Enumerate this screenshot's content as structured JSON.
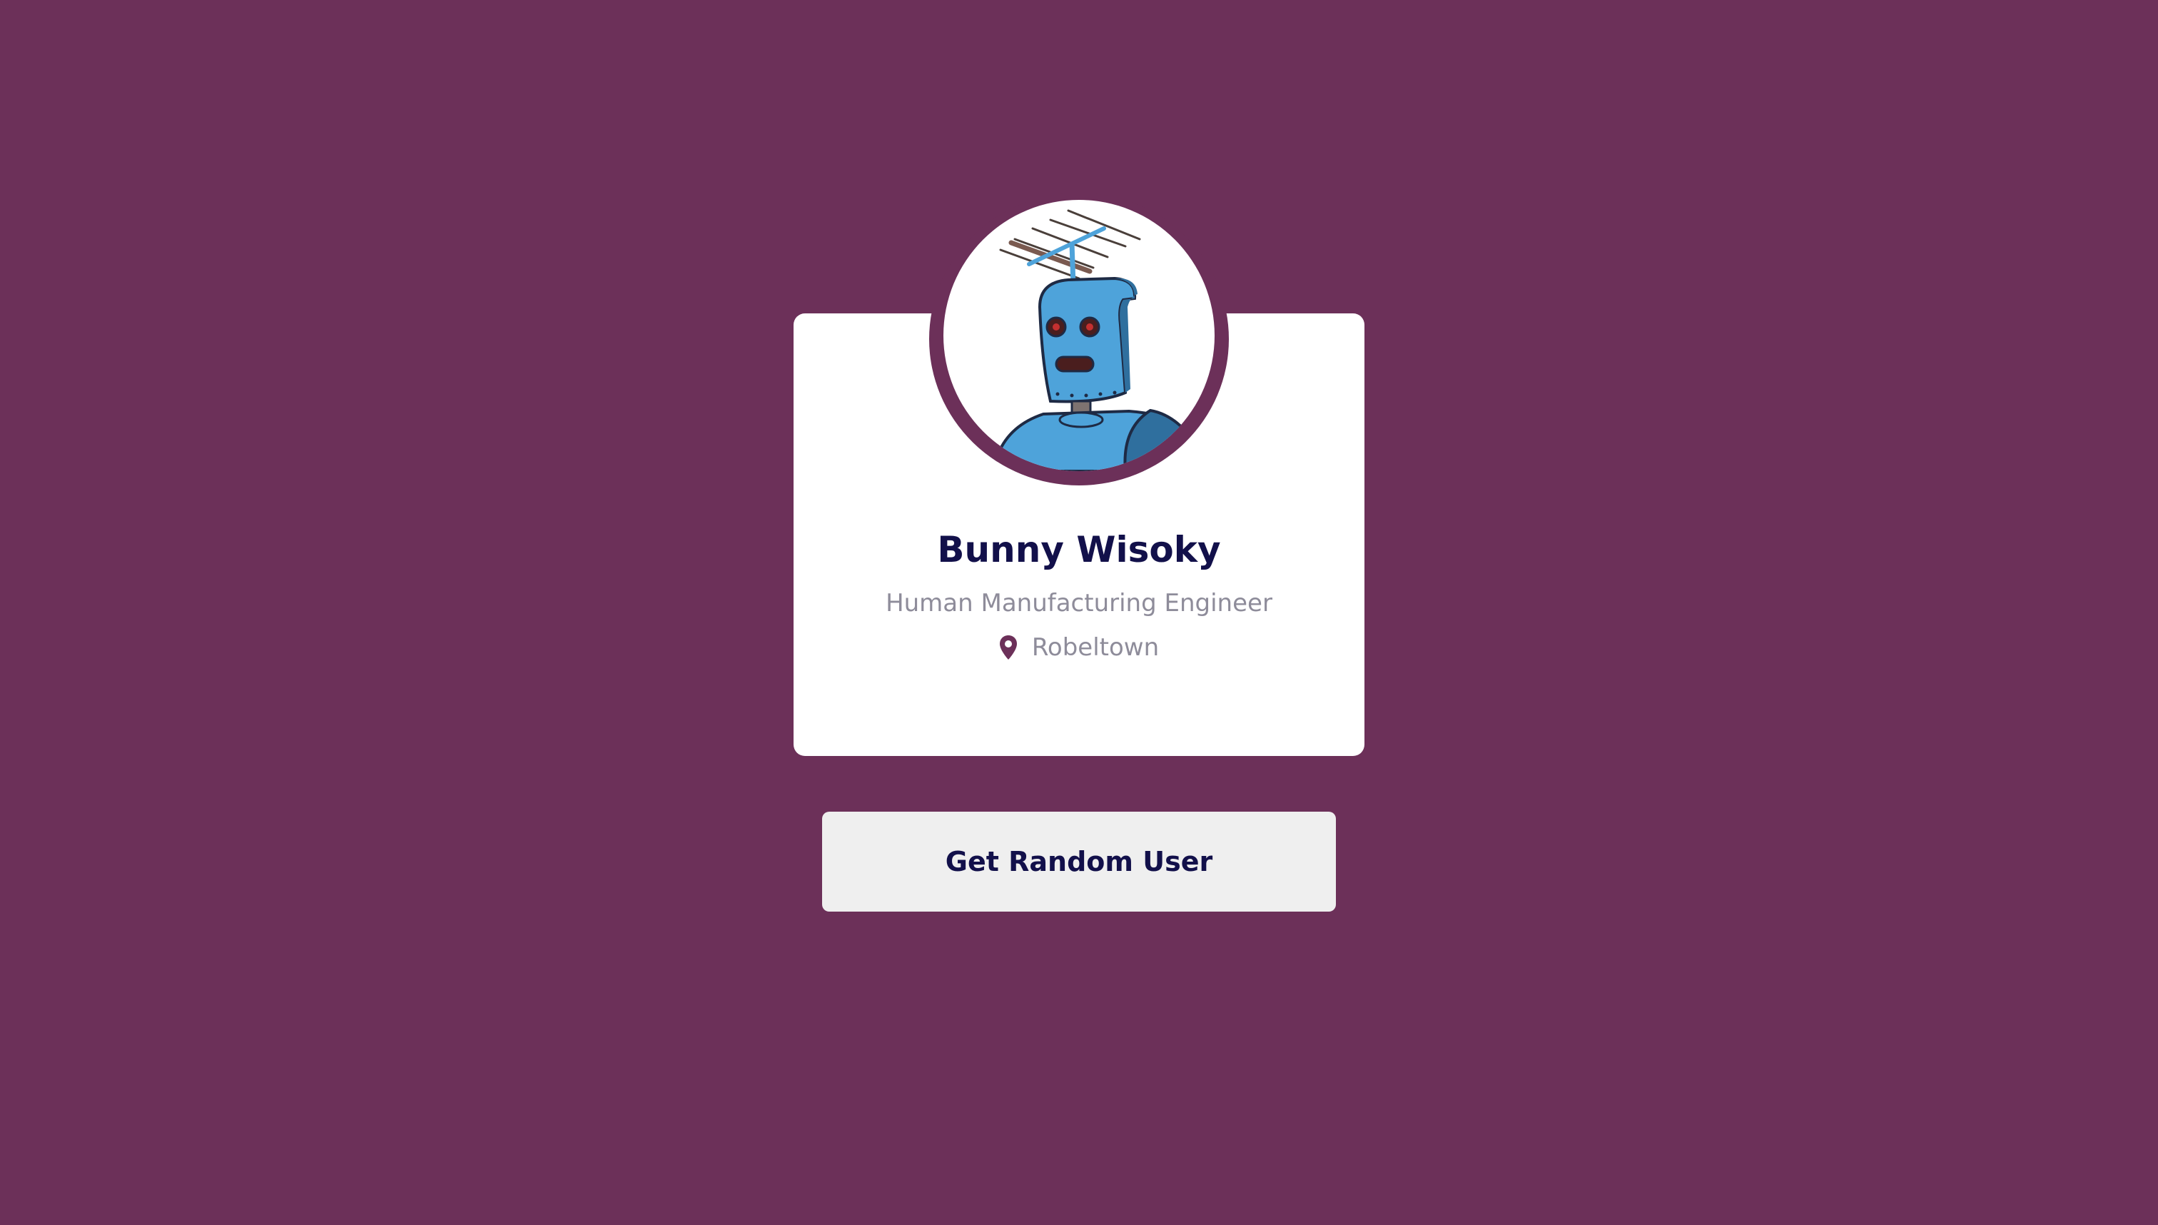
{
  "profile": {
    "name": "Bunny Wisoky",
    "job_title": "Human Manufacturing Engineer",
    "location": "Robeltown",
    "avatar_icon": "robot-avatar",
    "location_icon": "map-pin-icon"
  },
  "actions": {
    "random_user_label": "Get Random User"
  },
  "colors": {
    "background": "#6c3059",
    "card": "#ffffff",
    "name_text": "#12104a",
    "secondary_text": "#8e8c9a",
    "button_bg": "#efefef",
    "avatar_robot": "#4ea3da"
  }
}
